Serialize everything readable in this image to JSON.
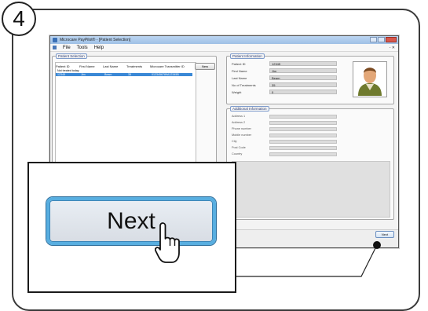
{
  "step": {
    "number": "4"
  },
  "window": {
    "title": "Microcare PayPilot® - [Patient Selection]",
    "menu": [
      "File",
      "Tools",
      "Help"
    ],
    "menu_right": "- ✕"
  },
  "patient_selection": {
    "legend": "Patient Selection",
    "columns": [
      "Patient ID",
      "First Name",
      "Last Name",
      "Treatments",
      "Microcare Transmitter ID"
    ],
    "new_button": "New",
    "rows": [
      {
        "cells": [
          "Not treated today",
          "",
          "",
          "",
          ""
        ],
        "selected": false
      },
      {
        "cells": [
          "12345",
          "Jim",
          "Beam",
          "35",
          "0123456789A12345B"
        ],
        "selected": true
      }
    ]
  },
  "patient_information": {
    "legend": "Patient Information",
    "fields": [
      {
        "label": "Patient ID",
        "value": "12345"
      },
      {
        "label": "First Name",
        "value": "Jim"
      },
      {
        "label": "Last Name",
        "value": "Beam"
      },
      {
        "label": "No of Treatments",
        "value": "35"
      },
      {
        "label": "Weight",
        "value": "0"
      }
    ]
  },
  "additional_information": {
    "legend": "Additional Information",
    "fields": [
      "Address 1",
      "Address 2",
      "Phone number",
      "Mobile number",
      "City",
      "Post Code",
      "Country"
    ]
  },
  "footer": {
    "next_small": "Next"
  },
  "callout": {
    "next_large": "Next"
  },
  "colors": {
    "accent": "#58aee0",
    "selection": "#3a88d6",
    "title_bar": "#9fc0e6"
  }
}
